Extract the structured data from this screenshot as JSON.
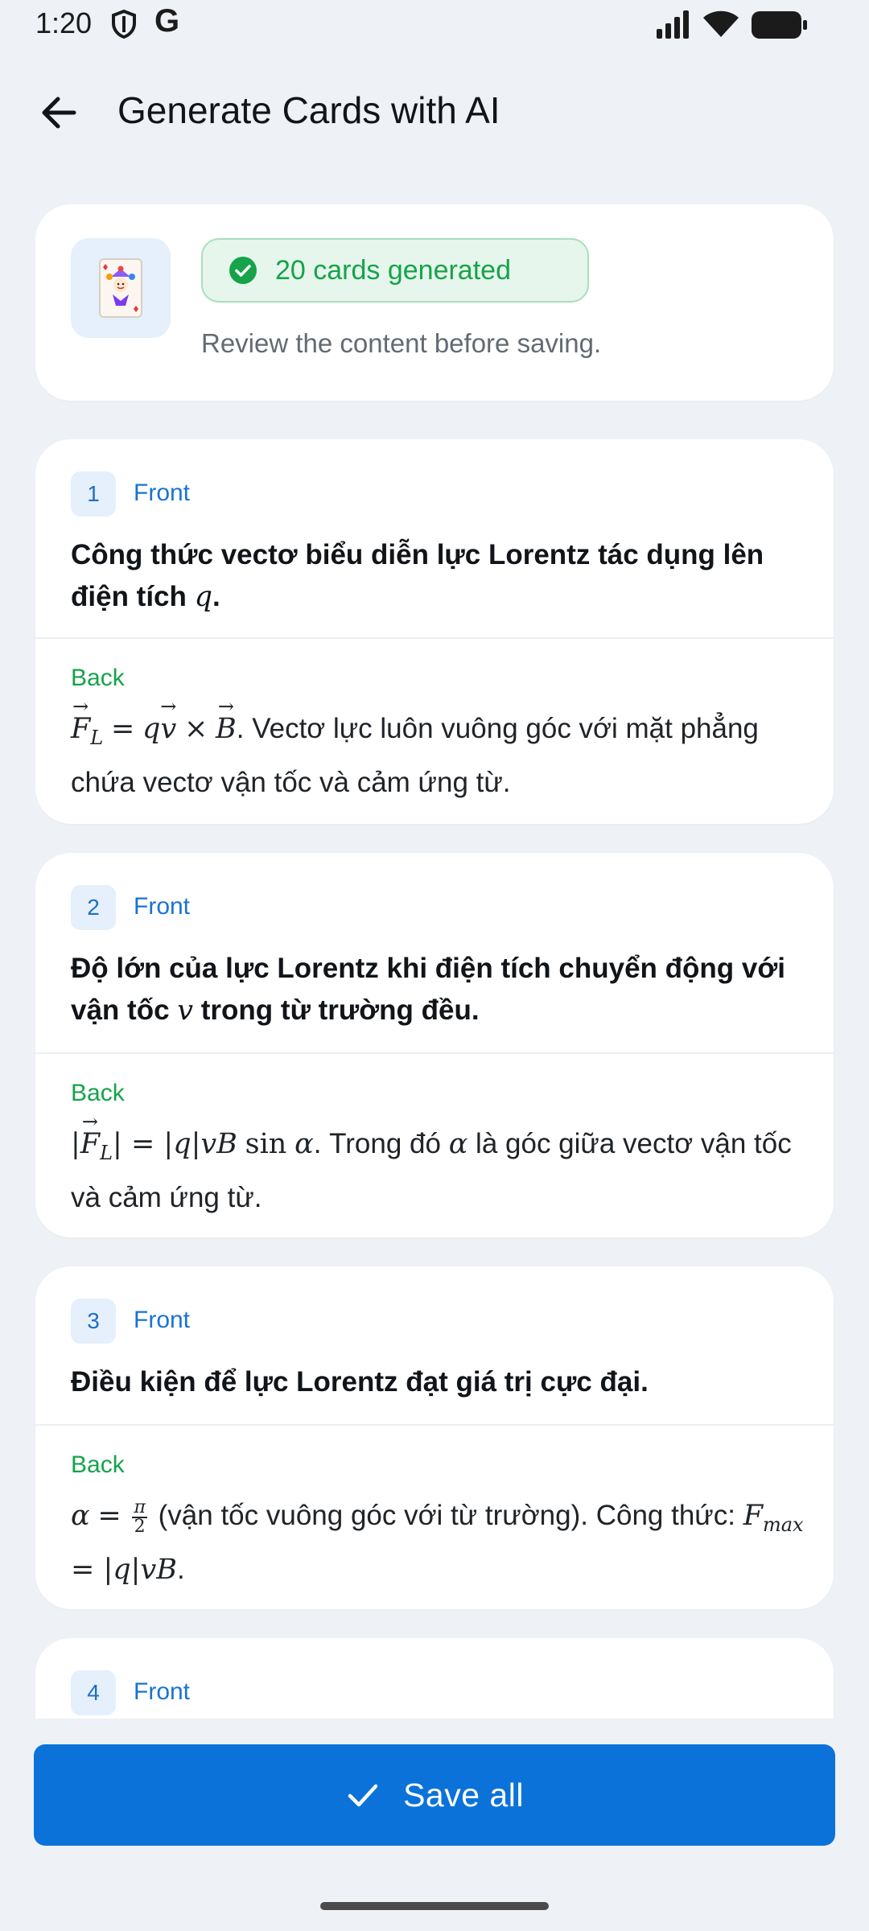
{
  "status_bar": {
    "time": "1:20",
    "g_glyph": "G",
    "icons": [
      "shield-icon",
      "signal-icon",
      "wifi-icon",
      "battery-icon"
    ]
  },
  "header": {
    "title": "Generate Cards with AI",
    "back_icon": "arrow-left-icon"
  },
  "summary": {
    "icon": "joker-card-icon",
    "badge": "20 cards generated",
    "subtitle": "Review the content before saving."
  },
  "labels": {
    "front": "Front",
    "back": "Back"
  },
  "cards": [
    {
      "number": "1",
      "front_text": "Công thức vectơ biểu diễn lực Lorentz tác dụng lên điện tích ",
      "front_math": "q",
      "back_text": ". Vectơ lực luôn vuông góc với mặt phẳng chứa vectơ vận tốc và cảm ứng từ."
    },
    {
      "number": "2",
      "front_text_a": "Độ lớn của lực Lorentz khi điện tích chuyển động với vận tốc ",
      "front_math": "v",
      "front_text_b": " trong từ trường đều.",
      "back_text_a": ". Trong đó ",
      "back_math": "α",
      "back_text_b": " là góc giữa vectơ vận tốc và cảm ứng từ."
    },
    {
      "number": "3",
      "front_text": "Điều kiện để lực Lorentz đạt giá trị cực đại.",
      "back_text_a": " (vận tốc vuông góc với từ trường). Công thức: ",
      "back_text_b": "."
    },
    {
      "number": "4"
    }
  ],
  "actions": {
    "save_all": "Save all",
    "save_icon": "check-icon"
  },
  "colors": {
    "primary": "#0b72d9",
    "success": "#16a34a",
    "background": "#eef1f5"
  }
}
